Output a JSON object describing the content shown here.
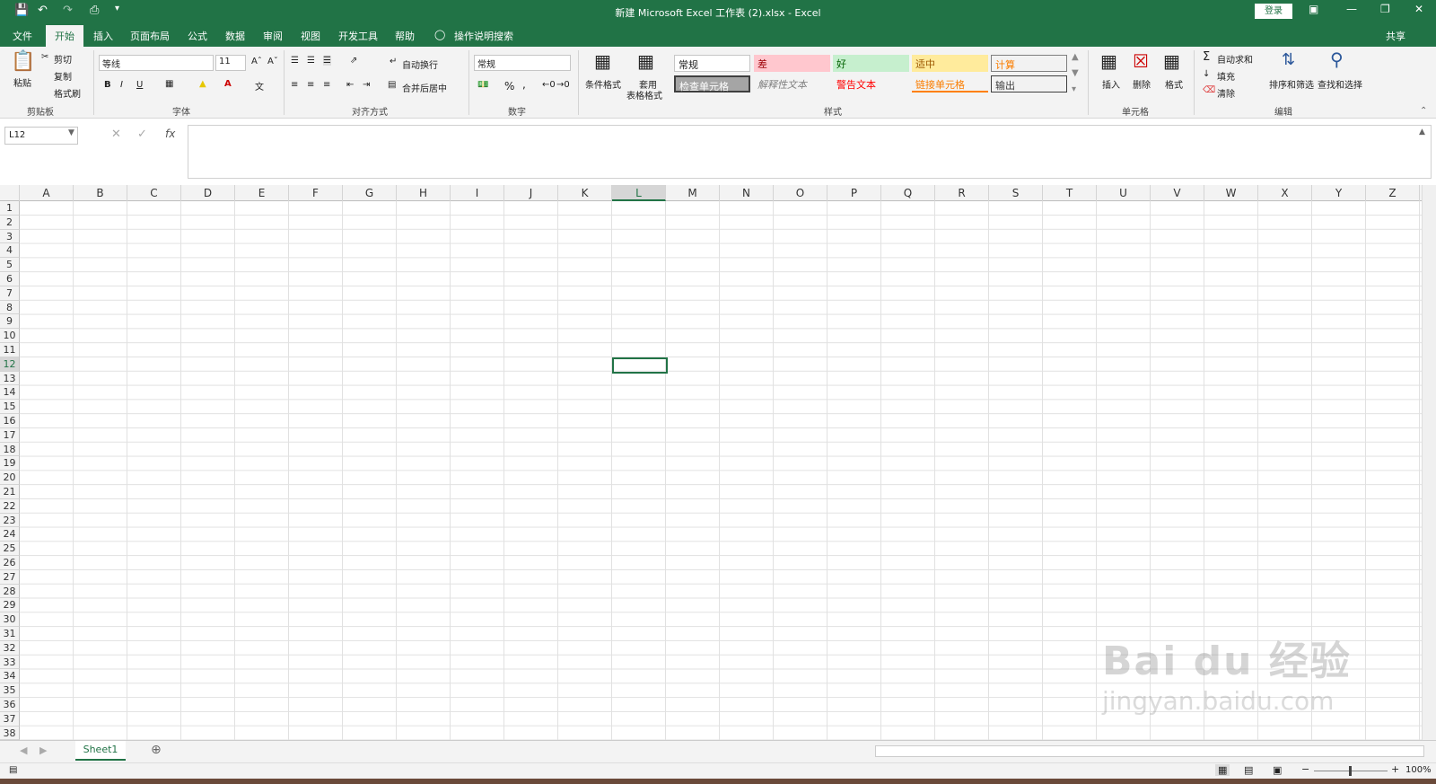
{
  "titlebar": {
    "title": "新建 Microsoft Excel 工作表 (2).xlsx  -  Excel",
    "login": "登录"
  },
  "tabs": [
    "文件",
    "开始",
    "插入",
    "页面布局",
    "公式",
    "数据",
    "审阅",
    "视图",
    "开发工具",
    "帮助"
  ],
  "tell_me": "操作说明搜索",
  "share": "共享",
  "clipboard": {
    "paste": "粘贴",
    "cut": "剪切",
    "copy": "复制",
    "format_painter": "格式刷",
    "label": "剪贴板"
  },
  "font": {
    "name": "等线",
    "size": "11",
    "label": "字体",
    "bold": "B",
    "italic": "I",
    "underline": "U"
  },
  "alignment": {
    "wrap": "自动换行",
    "merge": "合并后居中",
    "label": "对齐方式"
  },
  "number": {
    "format": "常规",
    "percent": "%",
    "comma": ",",
    "label": "数字"
  },
  "styles": {
    "cond": "条件格式",
    "table1": "套用",
    "table2": "表格格式",
    "label": "样式",
    "cells": [
      "常规",
      "差",
      "好",
      "适中",
      "计算",
      "检查单元格",
      "解释性文本",
      "警告文本",
      "链接单元格",
      "输出"
    ]
  },
  "cells_grp": {
    "insert": "插入",
    "delete": "删除",
    "format": "格式",
    "label": "单元格"
  },
  "editing": {
    "autosum": "自动求和",
    "fill": "填充",
    "clear": "清除",
    "sort": "排序和筛选",
    "find": "查找和选择",
    "label": "编辑"
  },
  "namebox": "L12",
  "fx": "fx",
  "columns": [
    "A",
    "B",
    "C",
    "D",
    "E",
    "F",
    "G",
    "H",
    "I",
    "J",
    "K",
    "L",
    "M",
    "N",
    "O",
    "P",
    "Q",
    "R",
    "S",
    "T",
    "U",
    "V",
    "W",
    "X",
    "Y",
    "Z"
  ],
  "rows": [
    "1",
    "2",
    "3",
    "4",
    "5",
    "6",
    "7",
    "8",
    "9",
    "10",
    "11",
    "12",
    "13",
    "14",
    "15",
    "16",
    "17",
    "18",
    "19",
    "20",
    "21",
    "22",
    "23",
    "24",
    "25",
    "26",
    "27",
    "28",
    "29",
    "30",
    "31",
    "32",
    "33",
    "34",
    "35",
    "36",
    "37",
    "38"
  ],
  "sheet": "Sheet1",
  "zoom": "100%",
  "watermark": {
    "brand": "Bai du 经验",
    "url": "jingyan.baidu.com"
  }
}
